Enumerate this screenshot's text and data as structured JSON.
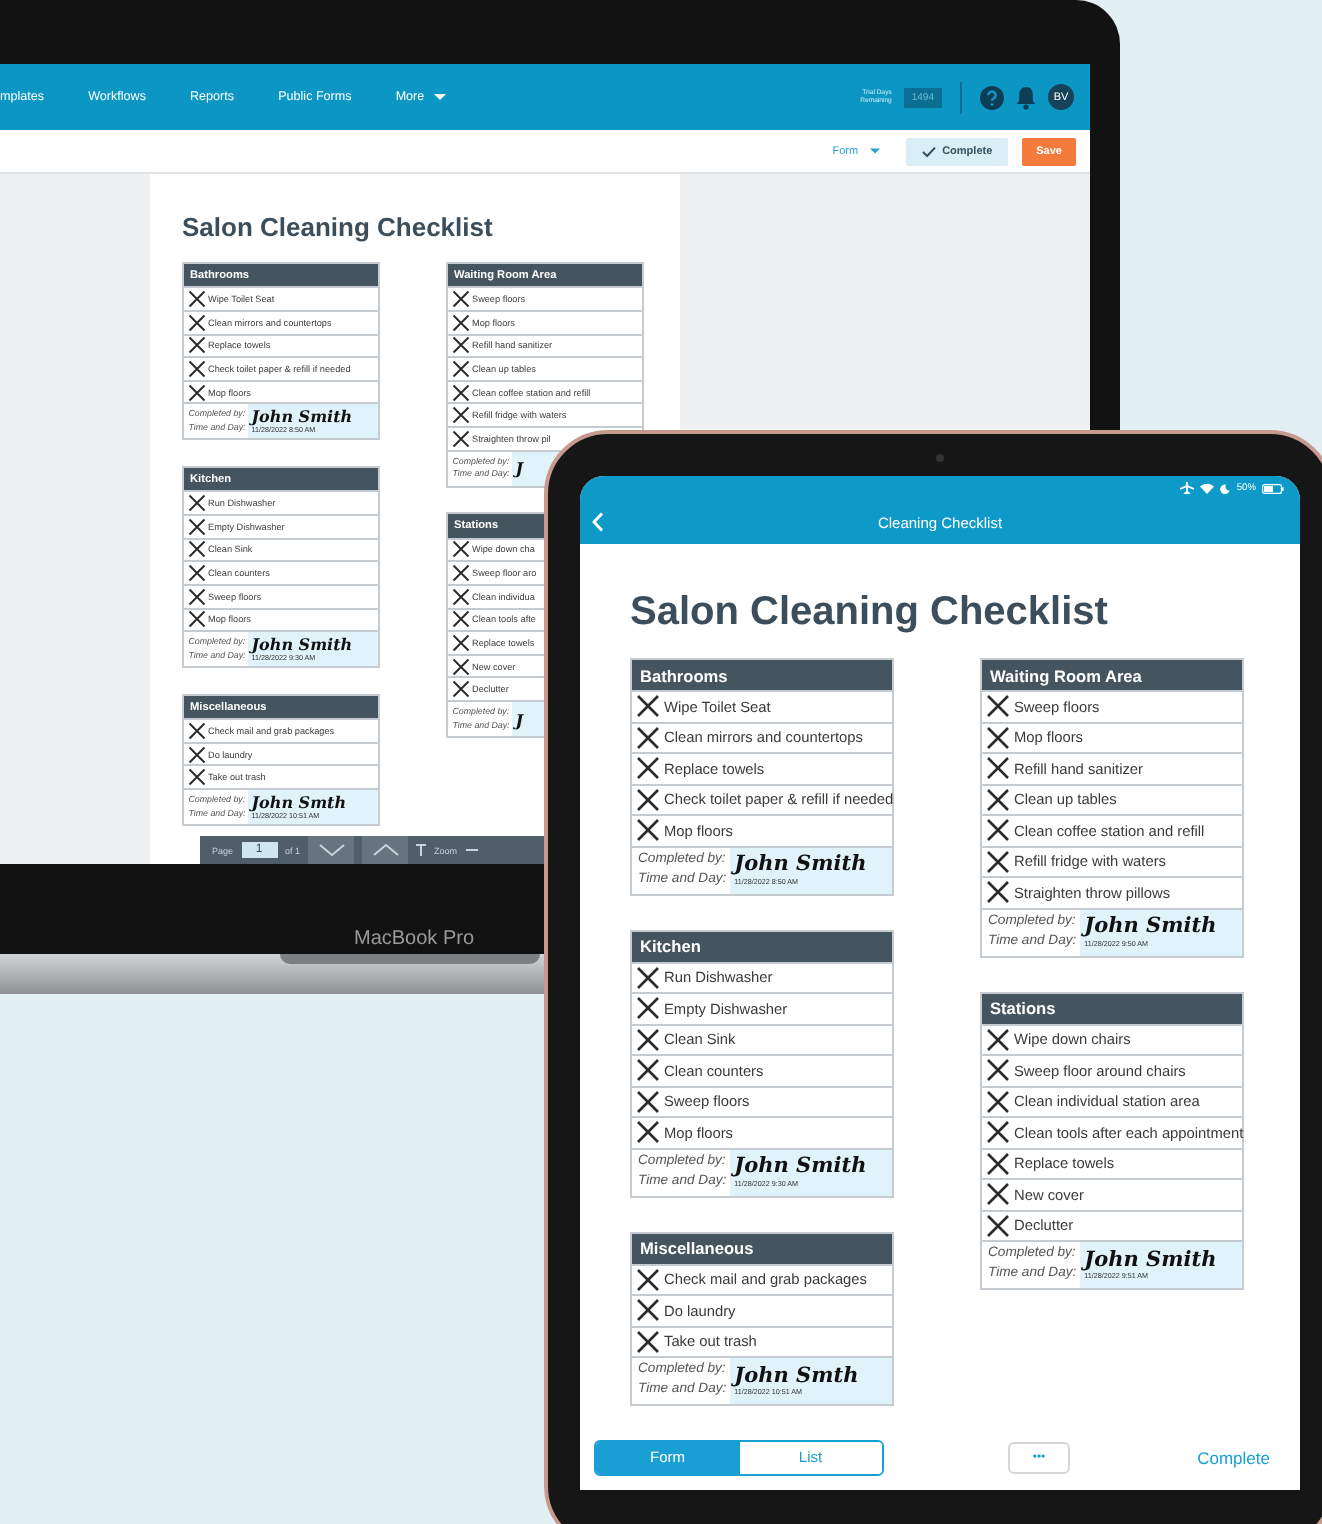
{
  "laptop": {
    "nav": {
      "items": [
        "mplates",
        "Workflows",
        "Reports",
        "Public Forms"
      ],
      "more": "More",
      "trial_label": "Trial Days Remaining",
      "trial_days": "1494",
      "avatar": "BV"
    },
    "toolbar": {
      "view": "Form",
      "complete": "Complete",
      "save": "Save"
    },
    "form": {
      "title": "Salon Cleaning Checklist",
      "columns": [
        {
          "sections": [
            {
              "title": "Bathrooms",
              "items": [
                {
                  "label": "Wipe Toilet Seat",
                  "checked": true
                },
                {
                  "label": "Clean mirrors and countertops",
                  "checked": true
                },
                {
                  "label": "Replace towels",
                  "checked": true
                },
                {
                  "label": "Check toilet paper & refill if needed",
                  "checked": true
                },
                {
                  "label": "Mop floors",
                  "checked": true
                }
              ],
              "completed_label": "Completed by:",
              "signature": "John Smith",
              "time_label": "Time and Day:",
              "time": "11/28/2022 8:50 AM"
            },
            {
              "title": "Kitchen",
              "items": [
                {
                  "label": "Run Dishwasher",
                  "checked": true
                },
                {
                  "label": "Empty Dishwasher",
                  "checked": true
                },
                {
                  "label": "Clean Sink",
                  "checked": true
                },
                {
                  "label": "Clean counters",
                  "checked": true
                },
                {
                  "label": "Sweep floors",
                  "checked": true
                },
                {
                  "label": "Mop floors",
                  "checked": true
                }
              ],
              "completed_label": "Completed by:",
              "signature": "John Smith",
              "time_label": "Time and Day:",
              "time": "11/28/2022 9:30 AM"
            },
            {
              "title": "Miscellaneous",
              "items": [
                {
                  "label": "Check mail and grab packages",
                  "checked": true
                },
                {
                  "label": "Do laundry",
                  "checked": true
                },
                {
                  "label": "Take out trash",
                  "checked": true
                }
              ],
              "completed_label": "Completed by:",
              "signature": "John Smth",
              "time_label": "Time and Day:",
              "time": "11/28/2022 10:51 AM"
            }
          ]
        },
        {
          "sections": [
            {
              "title": "Waiting Room Area",
              "items": [
                {
                  "label": "Sweep floors",
                  "checked": true
                },
                {
                  "label": "Mop floors",
                  "checked": true
                },
                {
                  "label": "Refill hand sanitizer",
                  "checked": true
                },
                {
                  "label": "Clean up tables",
                  "checked": true
                },
                {
                  "label": "Clean coffee station and refill",
                  "checked": true
                },
                {
                  "label": "Refill fridge with waters",
                  "checked": true
                },
                {
                  "label": "Straighten throw pil",
                  "checked": true
                }
              ],
              "completed_label": "Completed by:",
              "signature": "J",
              "time_label": "Time and Day:"
            },
            {
              "title": "Stations",
              "items": [
                {
                  "label": "Wipe down cha",
                  "checked": true
                },
                {
                  "label": "Sweep floor aro",
                  "checked": true
                },
                {
                  "label": "Clean individua",
                  "checked": true
                },
                {
                  "label": "Clean tools afte",
                  "checked": true
                },
                {
                  "label": "Replace towels",
                  "checked": true
                },
                {
                  "label": "New cover",
                  "checked": true
                },
                {
                  "label": "Declutter",
                  "checked": true
                }
              ],
              "completed_label": "Completed by:",
              "signature": "J",
              "time_label": "Time and Day:"
            }
          ]
        }
      ]
    },
    "pager": {
      "page_label": "Page",
      "page": "1",
      "of": "of 1",
      "zoom": "Zoom"
    },
    "brand": "MacBook Pro"
  },
  "tablet": {
    "status": {
      "battery": "50%"
    },
    "title": "Cleaning Checklist",
    "form": {
      "title": "Salon Cleaning Checklist",
      "columns": [
        {
          "sections": [
            {
              "title": "Bathrooms",
              "items": [
                {
                  "label": "Wipe Toilet Seat",
                  "checked": true
                },
                {
                  "label": "Clean mirrors and countertops",
                  "checked": true
                },
                {
                  "label": "Replace towels",
                  "checked": true
                },
                {
                  "label": "Check toilet paper & refill if needed",
                  "checked": true
                },
                {
                  "label": "Mop floors",
                  "checked": true
                }
              ],
              "completed_label": "Completed by:",
              "signature": "John Smith",
              "time_label": "Time and Day:",
              "time": "11/28/2022 8:50 AM"
            },
            {
              "title": "Kitchen",
              "items": [
                {
                  "label": "Run Dishwasher",
                  "checked": true
                },
                {
                  "label": "Empty Dishwasher",
                  "checked": true
                },
                {
                  "label": "Clean Sink",
                  "checked": true
                },
                {
                  "label": "Clean counters",
                  "checked": true
                },
                {
                  "label": "Sweep floors",
                  "checked": true
                },
                {
                  "label": "Mop floors",
                  "checked": true
                }
              ],
              "completed_label": "Completed by:",
              "signature": "John Smith",
              "time_label": "Time and Day:",
              "time": "11/28/2022 9:30 AM"
            },
            {
              "title": "Miscellaneous",
              "items": [
                {
                  "label": "Check mail and grab packages",
                  "checked": true
                },
                {
                  "label": "Do laundry",
                  "checked": true
                },
                {
                  "label": "Take out trash",
                  "checked": true
                }
              ],
              "completed_label": "Completed by:",
              "signature": "John Smth",
              "time_label": "Time and Day:",
              "time": "11/28/2022 10:51 AM"
            }
          ]
        },
        {
          "sections": [
            {
              "title": "Waiting Room Area",
              "items": [
                {
                  "label": "Sweep floors",
                  "checked": true
                },
                {
                  "label": "Mop floors",
                  "checked": true
                },
                {
                  "label": "Refill hand sanitizer",
                  "checked": true
                },
                {
                  "label": "Clean up tables",
                  "checked": true
                },
                {
                  "label": "Clean coffee station and refill",
                  "checked": true
                },
                {
                  "label": "Refill fridge with waters",
                  "checked": true
                },
                {
                  "label": "Straighten throw pillows",
                  "checked": true
                }
              ],
              "completed_label": "Completed by:",
              "signature": "John Smith",
              "time_label": "Time and Day:",
              "time": "11/28/2022 9:50 AM"
            },
            {
              "title": "Stations",
              "items": [
                {
                  "label": "Wipe down chairs",
                  "checked": true
                },
                {
                  "label": "Sweep floor around chairs",
                  "checked": true
                },
                {
                  "label": "Clean individual station area",
                  "checked": true
                },
                {
                  "label": "Clean tools after each appointment",
                  "checked": true
                },
                {
                  "label": "Replace towels",
                  "checked": true
                },
                {
                  "label": "New cover",
                  "checked": true
                },
                {
                  "label": "Declutter",
                  "checked": true
                }
              ],
              "completed_label": "Completed by:",
              "signature": "John Smith",
              "time_label": "Time and Day:",
              "time": "11/28/2022 9:51 AM"
            }
          ]
        }
      ]
    },
    "bottom": {
      "tabs": [
        {
          "label": "Form",
          "selected": true
        },
        {
          "label": "List",
          "selected": false
        }
      ],
      "more": "•••",
      "complete": "Complete"
    }
  }
}
